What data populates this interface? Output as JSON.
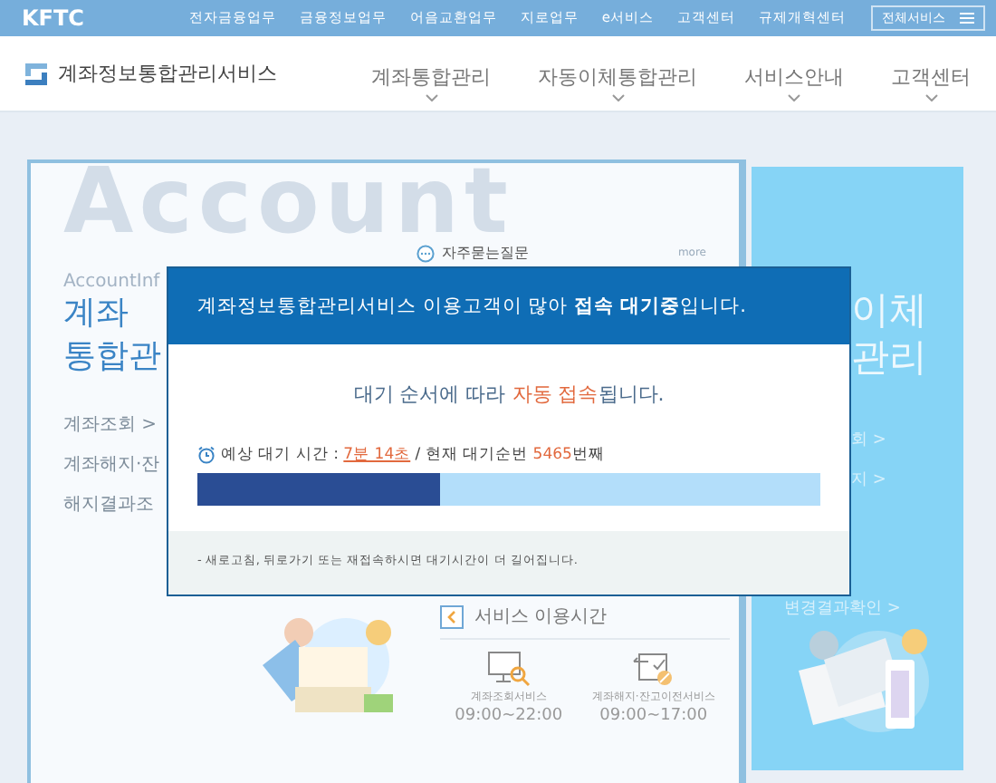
{
  "top_bar": {
    "brand": "KFTC",
    "links": [
      "전자금융업무",
      "금융정보업무",
      "어음교환업무",
      "지로업무",
      "e서비스",
      "고객센터",
      "규제개혁센터"
    ],
    "all_services": "전체서비스"
  },
  "header": {
    "title": "계좌정보통합관리서비스",
    "nav": [
      "계좌통합관리",
      "자동이체통합관리",
      "서비스안내",
      "고객센터"
    ]
  },
  "left_card": {
    "watermark": "Account",
    "faq": {
      "label": "자주묻는질문",
      "more": "more"
    },
    "subtitle": "AccountInf",
    "heading": [
      "계좌",
      "통합관"
    ],
    "links": [
      {
        "label": "계좌조회",
        "arrow": ">"
      },
      {
        "label": "계좌해지·잔"
      },
      {
        "label": "해지결과조"
      }
    ],
    "hours": {
      "title": "서비스 이용시간",
      "services": [
        {
          "name": "계좌조회서비스",
          "time": "09:00~22:00",
          "kind": "lookup"
        },
        {
          "name": "계좌해지·잔고이전서비스",
          "time": "09:00~17:00",
          "kind": "transfer"
        }
      ]
    }
  },
  "right_card": {
    "heading": [
      "이체",
      "관리"
    ],
    "links": [
      {
        "label": "회",
        "arrow": ">"
      },
      {
        "label": "지",
        "arrow": ">"
      },
      {
        "label": "변경결과확인",
        "arrow": ">"
      }
    ]
  },
  "modal": {
    "title": "계좌정보통합관리서비스 이용고객이 많아 **접속 대기중**입니다.",
    "message": [
      {
        "text": "대기 순서에 따라 ",
        "kind": "plain"
      },
      {
        "text": "자동 접속",
        "kind": "accent"
      },
      {
        "text": "됩니다.",
        "kind": "plain"
      }
    ],
    "wait": [
      {
        "text": "예상 대기 시간 : ",
        "kind": "plain"
      },
      {
        "text": "7분 14초",
        "kind": "link"
      },
      {
        "text": " / 현재 대기순번 ",
        "kind": "plain"
      },
      {
        "text": "5465",
        "kind": "accent"
      },
      {
        "text": "번째",
        "kind": "plain"
      }
    ],
    "progress": {
      "level": 0.39
    },
    "notice": "- 새로고침, 뒤로가기 또는 재접속하시면 대기시간이 더 길어집니다."
  }
}
